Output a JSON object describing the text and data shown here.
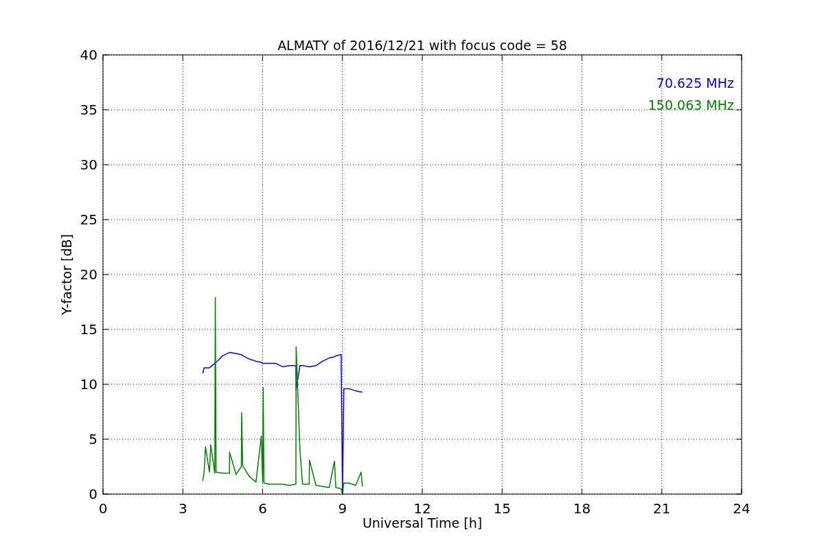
{
  "chart_data": {
    "type": "line",
    "title": "ALMATY of 2016/12/21 with focus code = 58",
    "xlabel": "Universal Time [h]",
    "ylabel": "Y-factor [dB]",
    "x": [
      3.75,
      3.8,
      3.85,
      4.0,
      4.05,
      4.2,
      4.22,
      4.25,
      4.5,
      4.75,
      4.76,
      5.0,
      5.2,
      5.21,
      5.25,
      5.5,
      5.75,
      5.95,
      6.0,
      6.02,
      6.05,
      6.25,
      6.5,
      6.75,
      7.0,
      7.25,
      7.26,
      7.4,
      7.5,
      7.75,
      7.76,
      8.0,
      8.25,
      8.5,
      8.7,
      8.75,
      8.95,
      9.0,
      9.05,
      9.25,
      9.5,
      9.7,
      9.75
    ],
    "series": [
      {
        "name": "70.625 MHz",
        "color": "#0000ff",
        "values": [
          11.0,
          11.5,
          11.5,
          11.5,
          11.6,
          11.9,
          12.0,
          12.0,
          12.6,
          12.9,
          12.9,
          12.8,
          12.7,
          12.7,
          12.6,
          12.3,
          12.1,
          12.0,
          11.9,
          11.9,
          11.9,
          11.9,
          11.9,
          11.6,
          11.7,
          11.7,
          9.5,
          11.7,
          11.7,
          11.6,
          11.6,
          11.7,
          12.1,
          12.4,
          12.5,
          12.6,
          12.7,
          0.0,
          9.6,
          9.6,
          9.4,
          9.3,
          9.3
        ]
      },
      {
        "name": "150.063 MHz",
        "color": "#008000",
        "values": [
          1.2,
          2.0,
          4.3,
          2.0,
          4.5,
          1.9,
          17.9,
          2.0,
          1.9,
          1.9,
          3.8,
          1.8,
          2.5,
          7.4,
          2.6,
          1.6,
          1.1,
          5.3,
          1.1,
          9.7,
          1.0,
          0.9,
          0.9,
          0.9,
          0.8,
          0.9,
          13.4,
          4.0,
          0.9,
          0.9,
          3.1,
          0.8,
          0.7,
          0.6,
          3.0,
          0.6,
          0.5,
          0.0,
          1.0,
          1.0,
          0.8,
          2.0,
          0.7
        ]
      }
    ],
    "xlim": [
      0,
      24
    ],
    "ylim": [
      0,
      40
    ],
    "xticks": [
      0,
      3,
      6,
      9,
      12,
      15,
      18,
      21,
      24
    ],
    "yticks": [
      0,
      5,
      10,
      15,
      20,
      25,
      30,
      35,
      40
    ],
    "grid": true
  }
}
